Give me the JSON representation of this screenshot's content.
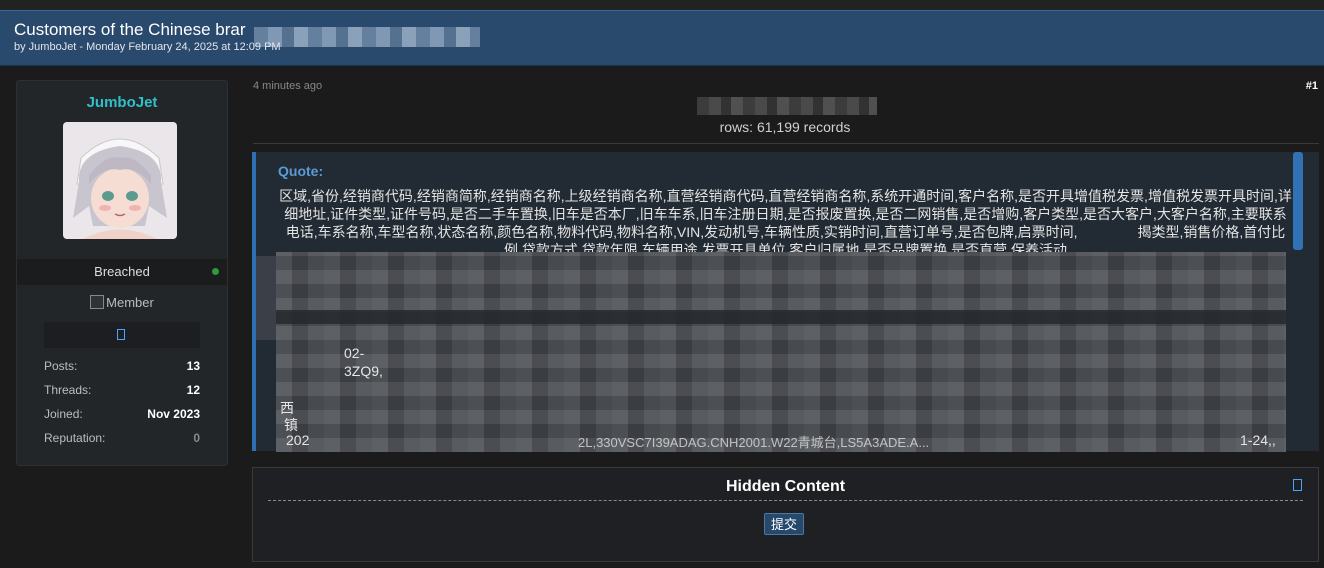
{
  "thread": {
    "title": "Customers of the Chinese brar",
    "byline": "by JumboJet - Monday February 24, 2025 at 12:09 PM"
  },
  "author": {
    "username": "JumboJet",
    "status": "Breached",
    "member_image_alt": "Member",
    "stats": [
      {
        "label": "Posts:",
        "value": "13"
      },
      {
        "label": "Threads:",
        "value": "12"
      },
      {
        "label": "Joined:",
        "value": "Nov 2023"
      },
      {
        "label": "Reputation:",
        "value": "0"
      }
    ]
  },
  "post": {
    "time": "4 minutes ago",
    "number": "#1",
    "rows_line": "rows: 61,199 records",
    "quote_label": "Quote:",
    "quote_text": "区域,省份,经销商代码,经销商简称,经销商名称,上级经销商名称,直营经销商代码,直营经销商名称,系统开通时间,客户名称,是否开具增值税发票,增值税发票开具时间,详细地址,证件类型,证件号码,是否二手车置换,旧车是否本厂,旧车车系,旧车注册日期,是否报废置换,是否二网销售,是否增购,客户类型,是否大客户,大客户名称,主要联系电话,车系名称,车型名称,状态名称,颜色名称,物料代码,物料名称,VIN,发动机号,车辆性质,实销时间,直营订单号,是否包牌,启票时间,",
    "quote_text_partial": "揭类型,销售价格,首付比例,贷款方式,贷款年限,车辆用途,发票开具单位,客户归属地,是否品牌置换,是否直营,保养活动",
    "snippets": {
      "s1": "02-",
      "s2": "3ZQ9,",
      "s3": "西",
      "s4": "镇",
      "s5": "202",
      "s6": "2L,330VSC7I39ADAG.CNH2001.W22青城台,LS5A3ADE.A...",
      "s7": "1-24,,"
    }
  },
  "hidden": {
    "title": "Hidden Content",
    "button_label": "提交"
  },
  "icons": [
    "lock-icon",
    "badge-icon"
  ],
  "colors": {
    "header": "#2a4a6d",
    "username": "#2fc0c9",
    "quote_accent": "#2f6fb3",
    "online": "#2e9a3a"
  }
}
